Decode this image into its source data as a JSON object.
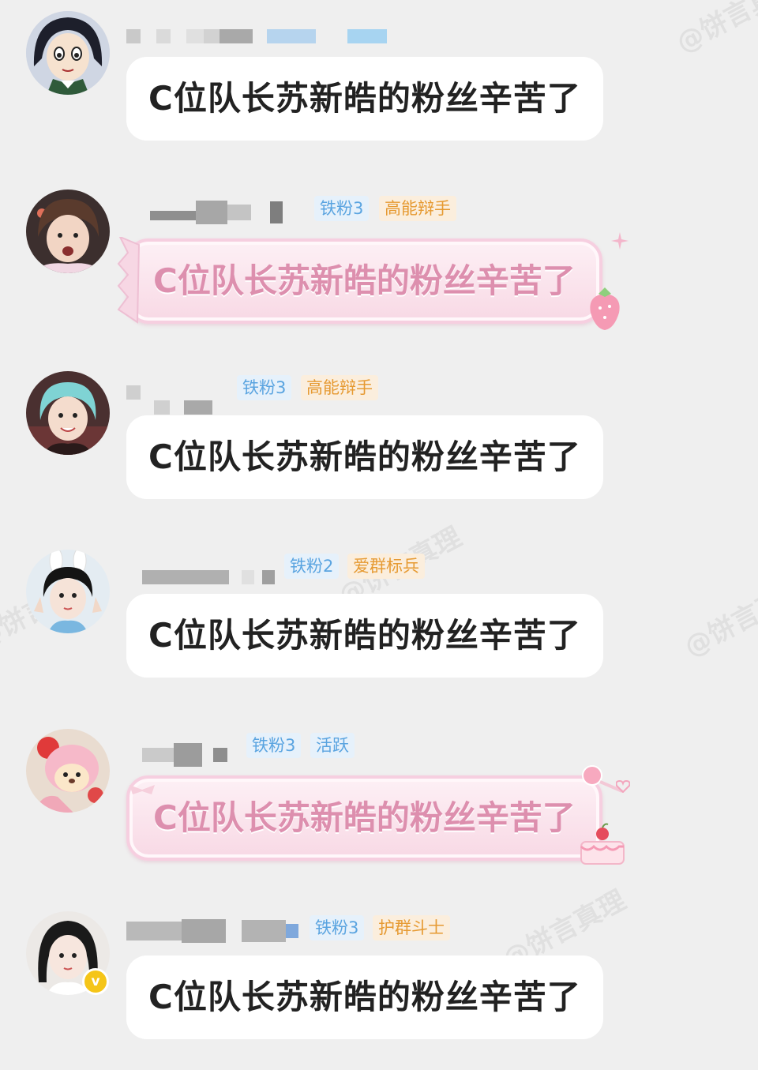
{
  "watermark": {
    "text": "@饼言真理"
  },
  "messages": [
    {
      "text": "C位队长苏新皓的粉丝辛苦了",
      "style": "plain",
      "avatar_icon": "anime-girl-avatar",
      "tags": []
    },
    {
      "text": "C位队长苏新皓的粉丝辛苦了",
      "style": "candy-bubble",
      "avatar_icon": "boy-avatar",
      "tags": [
        {
          "label": "铁粉3",
          "color": "blue"
        },
        {
          "label": "高能辩手",
          "color": "orange"
        }
      ]
    },
    {
      "text": "C位队长苏新皓的粉丝辛苦了",
      "style": "plain",
      "avatar_icon": "cyan-hair-avatar",
      "tags": [
        {
          "label": "铁粉3",
          "color": "blue"
        },
        {
          "label": "高能辩手",
          "color": "orange"
        }
      ]
    },
    {
      "text": "C位队长苏新皓的粉丝辛苦了",
      "style": "plain",
      "avatar_icon": "bunny-ears-avatar",
      "tags": [
        {
          "label": "铁粉2",
          "color": "blue"
        },
        {
          "label": "爱群标兵",
          "color": "orange"
        }
      ]
    },
    {
      "text": "C位队长苏新皓的粉丝辛苦了",
      "style": "cake-bubble",
      "avatar_icon": "plush-toy-avatar",
      "tags": [
        {
          "label": "铁粉3",
          "color": "blue"
        },
        {
          "label": "活跃",
          "color": "blue"
        }
      ]
    },
    {
      "text": "C位队长苏新皓的粉丝辛苦了",
      "style": "plain",
      "avatar_icon": "girl-avatar",
      "verified_icon": "verified-v-icon",
      "verified_text": "v",
      "tags": [
        {
          "label": "铁粉3",
          "color": "blue"
        },
        {
          "label": "护群斗士",
          "color": "orange"
        }
      ]
    }
  ],
  "colors": {
    "background": "#efefef",
    "bubble": "#ffffff",
    "tag_blue_bg": "#e6f1fb",
    "tag_blue_text": "#5aa4e0",
    "tag_orange_bg": "#fbeedd",
    "tag_orange_text": "#e69a32",
    "fancy_text": "#dd8fae"
  }
}
